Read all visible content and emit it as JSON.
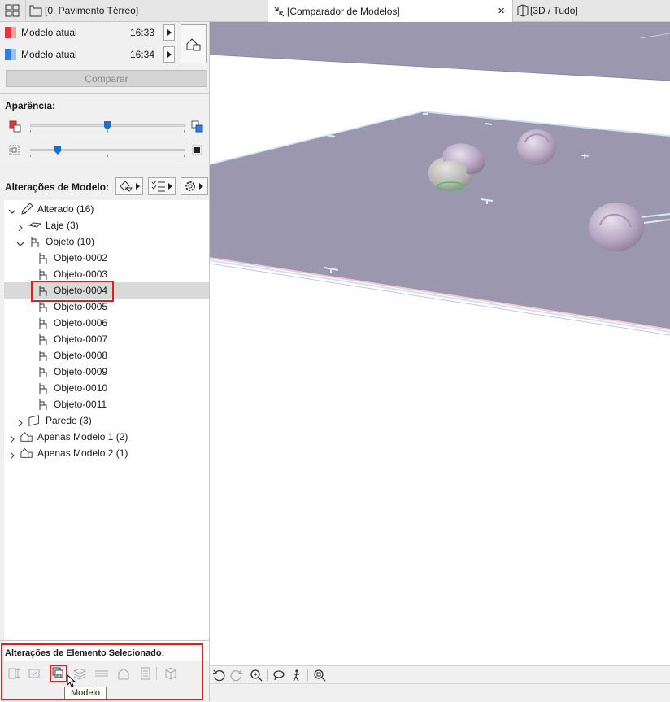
{
  "tabs": [
    {
      "label": "[0. Pavimento Térreo]",
      "icon": "floor-plan-icon"
    },
    {
      "label": "[Comparador de Modelos]",
      "icon": "compare-arrows-icon",
      "active": true,
      "close_symbol": "✕"
    },
    {
      "label": "[3D / Tudo]",
      "icon": "3d-view-icon"
    }
  ],
  "models": [
    {
      "name": "Modelo atual",
      "time": "16:33",
      "color": "#e8343a"
    },
    {
      "name": "Modelo atual",
      "time": "16:34",
      "color": "#2f7de1"
    }
  ],
  "compare_button": "Comparar",
  "appearance": {
    "title": "Aparência:",
    "slider1_value": 0.5,
    "slider2_value": 0.18
  },
  "model_changes": {
    "title": "Alterações de Modelo:",
    "buttons": [
      "filter-icon",
      "checklist-icon",
      "settings-icon"
    ]
  },
  "tree": [
    {
      "label": "Alterado (16)",
      "level": 0,
      "expanded": true,
      "icon": "pencil-icon"
    },
    {
      "label": "Laje (3)",
      "level": 1,
      "expanded": false,
      "icon": "slab-icon"
    },
    {
      "label": "Objeto (10)",
      "level": 1,
      "expanded": true,
      "icon": "chair-icon"
    },
    {
      "label": "Objeto-0002",
      "level": 2,
      "icon": "chair-icon"
    },
    {
      "label": "Objeto-0003",
      "level": 2,
      "icon": "chair-icon"
    },
    {
      "label": "Objeto-0004",
      "level": 2,
      "icon": "chair-icon",
      "selected": true
    },
    {
      "label": "Objeto-0005",
      "level": 2,
      "icon": "chair-icon"
    },
    {
      "label": "Objeto-0006",
      "level": 2,
      "icon": "chair-icon"
    },
    {
      "label": "Objeto-0007",
      "level": 2,
      "icon": "chair-icon"
    },
    {
      "label": "Objeto-0008",
      "level": 2,
      "icon": "chair-icon"
    },
    {
      "label": "Objeto-0009",
      "level": 2,
      "icon": "chair-icon"
    },
    {
      "label": "Objeto-0010",
      "level": 2,
      "icon": "chair-icon"
    },
    {
      "label": "Objeto-0011",
      "level": 2,
      "icon": "chair-icon"
    },
    {
      "label": "Parede (3)",
      "level": 1,
      "expanded": false,
      "icon": "wall-icon"
    },
    {
      "label": "Apenas Modelo 1 (2)",
      "level": 0,
      "expanded": false,
      "icon": "model-house-icon"
    },
    {
      "label": "Apenas Modelo 2 (1)",
      "level": 0,
      "expanded": false,
      "icon": "model-house-icon"
    }
  ],
  "selected_element_changes": {
    "title": "Alterações de Elemento Selecionado:",
    "tooltip": "Modelo"
  },
  "colors": {
    "highlight": "#e0201c",
    "slab": "#9b97ae",
    "accent_blue": "#1a6fd6"
  }
}
